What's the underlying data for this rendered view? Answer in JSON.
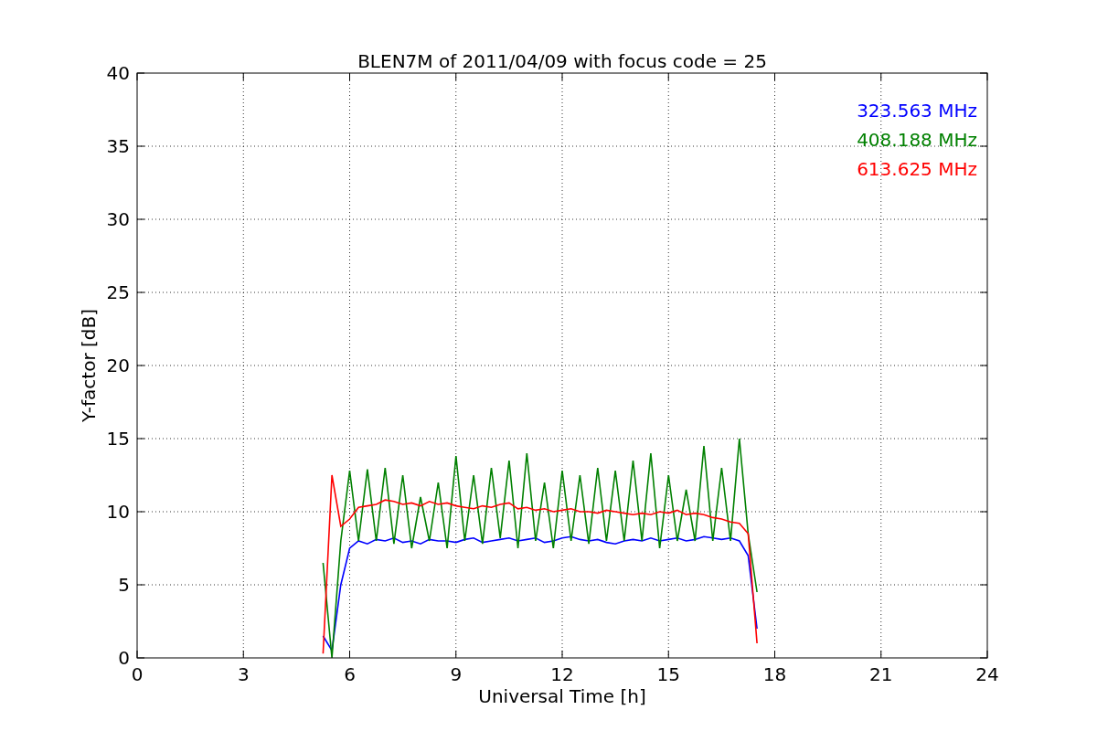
{
  "figure": {
    "chart_data": {
      "type": "line",
      "title": "BLEN7M of 2011/04/09 with focus code = 25",
      "xlabel": "Universal Time [h]",
      "ylabel": "Y-factor [dB]",
      "x": [
        5.25,
        5.5,
        5.75,
        6,
        6.25,
        6.5,
        6.75,
        7,
        7.25,
        7.5,
        7.75,
        8,
        8.25,
        8.5,
        8.75,
        9,
        9.25,
        9.5,
        9.75,
        10,
        10.25,
        10.5,
        10.75,
        11,
        11.25,
        11.5,
        11.75,
        12,
        12.25,
        12.5,
        12.75,
        13,
        13.25,
        13.5,
        13.75,
        14,
        14.25,
        14.5,
        14.75,
        15,
        15.25,
        15.5,
        15.75,
        16,
        16.25,
        16.5,
        16.75,
        17,
        17.25,
        17.5
      ],
      "series": [
        {
          "name": "323.563 MHz",
          "color": "#0000ff",
          "values": [
            1.5,
            0.5,
            5,
            7.5,
            8,
            7.8,
            8.1,
            8,
            8.2,
            7.9,
            8,
            7.8,
            8.1,
            8,
            8,
            7.9,
            8.1,
            8.2,
            7.9,
            8,
            8.1,
            8.2,
            8,
            8.1,
            8.2,
            7.9,
            8,
            8.2,
            8.3,
            8.1,
            8,
            8.1,
            7.9,
            7.8,
            8,
            8.1,
            8,
            8.2,
            8,
            8.1,
            8.2,
            8,
            8.1,
            8.3,
            8.2,
            8.1,
            8.2,
            8,
            7,
            2
          ]
        },
        {
          "name": "408.188 MHz",
          "color": "#008000",
          "values": [
            6.5,
            0,
            8,
            12.8,
            8,
            12.9,
            8,
            13,
            7.8,
            12.5,
            7.5,
            11,
            8,
            12,
            7.5,
            13.8,
            8,
            12.5,
            7.8,
            13,
            8.2,
            13.5,
            7.5,
            14,
            8,
            12,
            7.5,
            12.8,
            8,
            12.5,
            7.8,
            13,
            8,
            12.8,
            8,
            13.5,
            8,
            14,
            7.5,
            12.5,
            8,
            11.5,
            8,
            14.5,
            8,
            13,
            8,
            15,
            8.5,
            4.5
          ]
        },
        {
          "name": "613.625 MHz",
          "color": "#ff0000",
          "values": [
            0.3,
            12.5,
            9,
            9.5,
            10.3,
            10.4,
            10.5,
            10.8,
            10.7,
            10.5,
            10.6,
            10.4,
            10.7,
            10.5,
            10.6,
            10.4,
            10.3,
            10.2,
            10.4,
            10.3,
            10.5,
            10.6,
            10.2,
            10.3,
            10.1,
            10.2,
            10,
            10.1,
            10.2,
            10,
            10,
            9.9,
            10.1,
            10,
            9.9,
            9.8,
            9.9,
            9.8,
            10,
            9.9,
            10.1,
            9.8,
            9.9,
            9.8,
            9.6,
            9.5,
            9.3,
            9.2,
            8.5,
            1
          ]
        }
      ],
      "grid": true,
      "xlim": [
        0,
        24
      ],
      "ylim": [
        0,
        40
      ],
      "xticks": [
        0,
        3,
        6,
        9,
        12,
        15,
        18,
        21,
        24
      ],
      "yticks": [
        0,
        5,
        10,
        15,
        20,
        25,
        30,
        35,
        40
      ]
    }
  }
}
